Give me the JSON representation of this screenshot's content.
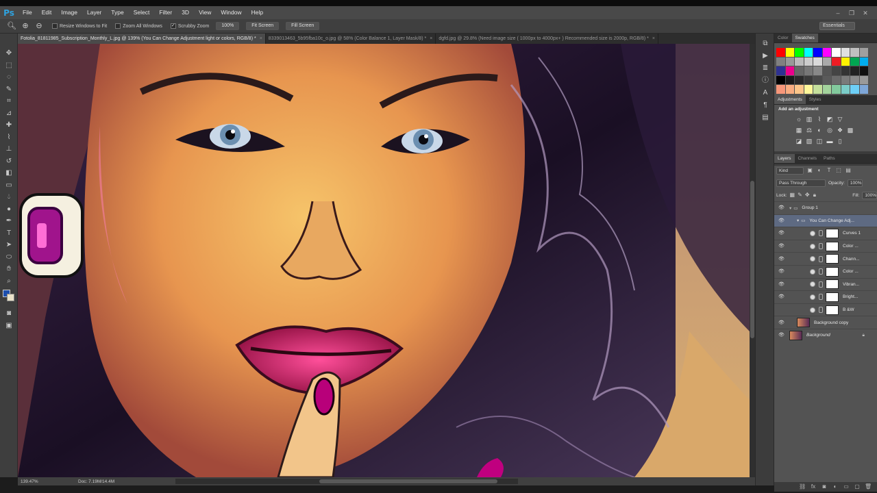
{
  "app": {
    "logo": "Ps"
  },
  "menu": [
    "File",
    "Edit",
    "Image",
    "Layer",
    "Type",
    "Select",
    "Filter",
    "3D",
    "View",
    "Window",
    "Help"
  ],
  "options": {
    "resize_label": "Resize Windows to Fit",
    "zoom_all_label": "Zoom All Windows",
    "scrubby_label": "Scrubby Zoom",
    "zoom_value": "100%",
    "fit_screen": "Fit Screen",
    "fill_screen": "Fill Screen",
    "workspace": "Essentials"
  },
  "tabs": [
    {
      "title": "Fotolia_81811985_Subscription_Monthly_L.jpg @ 139% (You Can Change Adjustment light or colors, RGB/8) *"
    },
    {
      "title": "8339013463_5b95fba10c_o.jpg @ 58% (Color Balance 1, Layer Mask/8) *"
    },
    {
      "title": "dgfd.jpg @ 29.8% (Need image size ( 1000px to 4000px+ ) Recommended size is 2000p, RGB/8) *"
    }
  ],
  "status": {
    "zoom": "139.47%",
    "doc": "Doc: 7.19M/14.4M"
  },
  "panels": {
    "color_tab": "Color",
    "swatches_tab": "Swatches",
    "adjustments_tab": "Adjustments",
    "styles_tab": "Styles",
    "add_adjustment": "Add an adjustment",
    "layers_tab": "Layers",
    "channels_tab": "Channels",
    "paths_tab": "Paths"
  },
  "layers_panel": {
    "kind": "Kind",
    "blend_mode": "Pass Through",
    "opacity_label": "Opacity:",
    "opacity": "100%",
    "lock_label": "Lock:",
    "fill_label": "Fill:",
    "fill": "100%"
  },
  "layers": [
    {
      "name": "Group 1"
    },
    {
      "name": "You Can Change Adj..."
    },
    {
      "name": "Curves 1"
    },
    {
      "name": "Color ..."
    },
    {
      "name": "Chann..."
    },
    {
      "name": "Color ..."
    },
    {
      "name": "Vibran..."
    },
    {
      "name": "Bright..."
    },
    {
      "name": "B &W"
    },
    {
      "name": "Background copy"
    },
    {
      "name": "Background"
    }
  ],
  "swatch_colors": [
    "#ff0000",
    "#ffff00",
    "#00ff00",
    "#00ffff",
    "#0000ff",
    "#ff00ff",
    "#ffffff",
    "#e0e0e0",
    "#c0c0c0",
    "#a0a0a0",
    "#808080",
    "#999999",
    "#bbbbbb",
    "#cccccc",
    "#d9d9d9",
    "#aaaaaa",
    "#ed1c24",
    "#fff200",
    "#00a651",
    "#00aeef",
    "#2e3192",
    "#ec008c",
    "#666666",
    "#777777",
    "#888888",
    "#555555",
    "#444444",
    "#333333",
    "#222222",
    "#111111",
    "#000000",
    "#1a1a1a",
    "#2a2a2a",
    "#3a3a3a",
    "#4a4a4a",
    "#5a5a5a",
    "#6a6a6a",
    "#7a7a7a",
    "#8a8a8a",
    "#9a9a9a",
    "#f7977a",
    "#f9ad81",
    "#fdc68a",
    "#fff79a",
    "#c4df9b",
    "#a3d39c",
    "#82ca9d",
    "#7bcdc8",
    "#6ecff6",
    "#7ea7d8"
  ]
}
